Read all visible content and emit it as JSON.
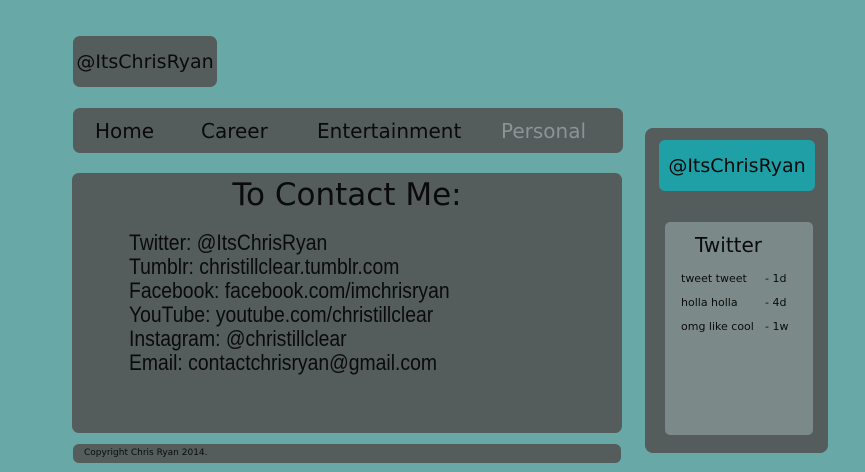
{
  "header": {
    "logo_text": "@ItsChrisRyan"
  },
  "nav": {
    "items": [
      {
        "label": "Home"
      },
      {
        "label": "Career"
      },
      {
        "label": "Entertainment"
      },
      {
        "label": "Personal"
      }
    ],
    "active_item": "Personal"
  },
  "main": {
    "title": "To Contact Me:",
    "contacts": [
      "Twitter: @ItsChrisRyan",
      "Tumblr: christillclear.tumblr.com",
      "Facebook: facebook.com/imchrisryan",
      "YouTube: youtube.com/christillclear",
      "Instagram: @christillclear",
      "Email: contactchrisryan@gmail.com"
    ]
  },
  "footer": {
    "copyright": "Copyright Chris Ryan 2014."
  },
  "sidebar": {
    "handle": "@ItsChrisRyan",
    "twitter": {
      "title": "Twitter",
      "tweets": [
        {
          "text": "tweet tweet",
          "time": "- 1d"
        },
        {
          "text": "holla holla",
          "time": "- 4d"
        },
        {
          "text": "omg like cool",
          "time": "- 1w"
        }
      ]
    }
  },
  "colors": {
    "page_background": "#68a8a6",
    "panel": "#545c5c",
    "accent": "#1f9fa6",
    "twitter_panel": "#7b8a88",
    "active_nav_text": "#8b9494"
  }
}
